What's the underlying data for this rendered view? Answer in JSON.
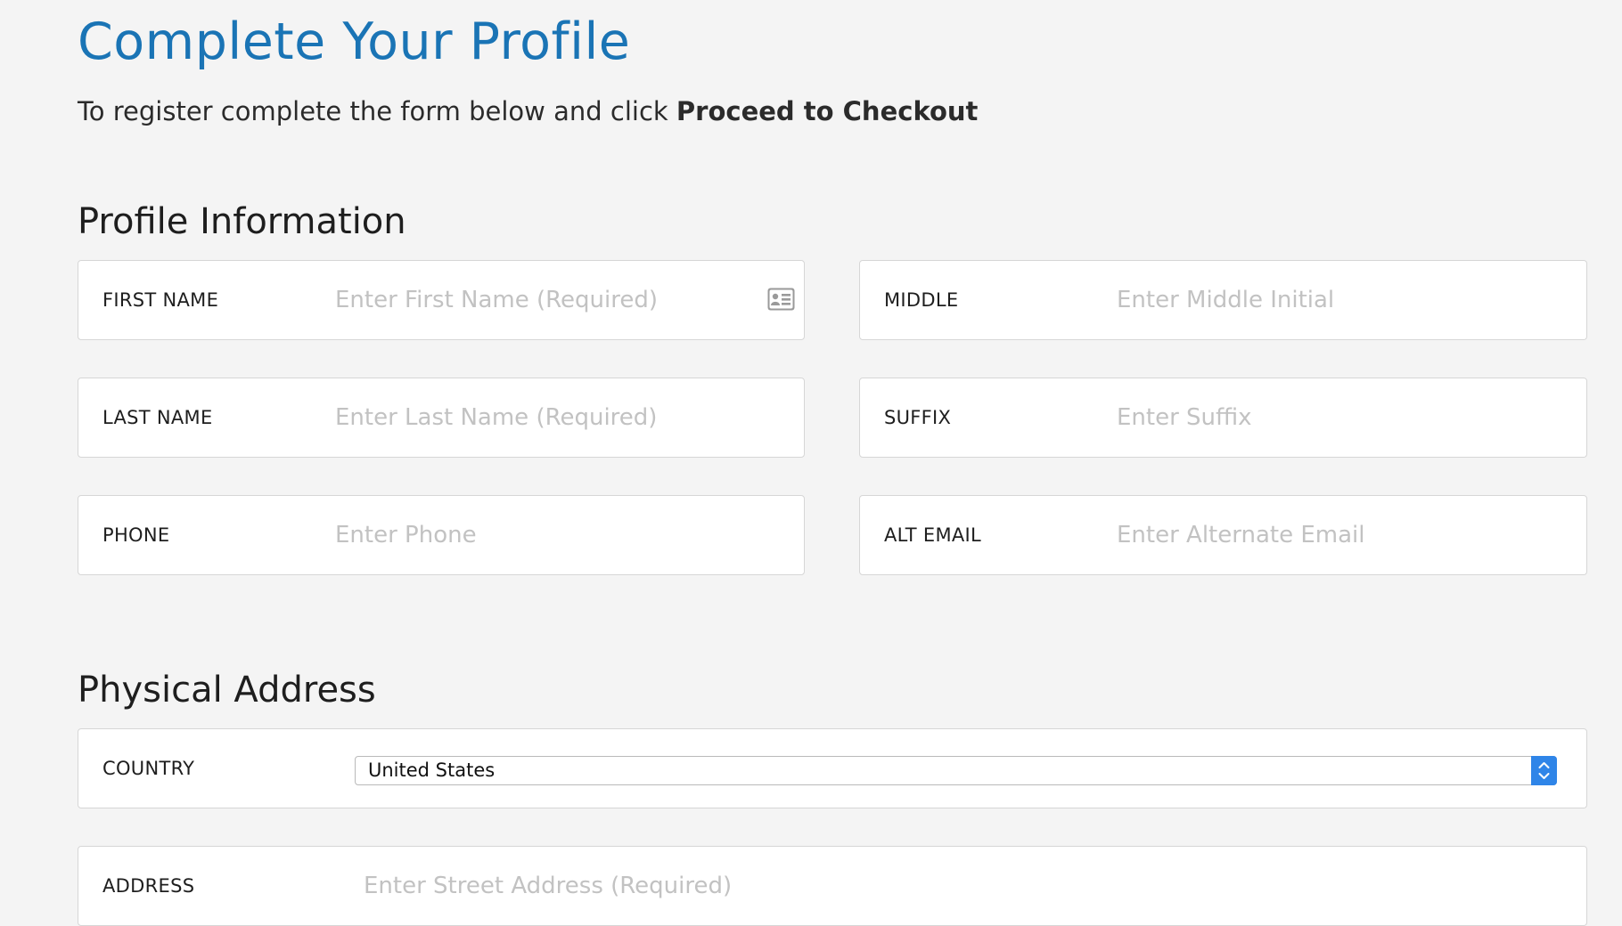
{
  "header": {
    "title": "Complete Your Profile",
    "subtitle_prefix": "To register complete the form below and click ",
    "subtitle_action": "Proceed to Checkout"
  },
  "profile_section": {
    "heading": "Profile Information",
    "fields": {
      "first_name": {
        "label": "FIRST NAME",
        "placeholder": "Enter First Name (Required)",
        "value": ""
      },
      "middle": {
        "label": "MIDDLE",
        "placeholder": "Enter Middle Initial",
        "value": ""
      },
      "last_name": {
        "label": "LAST NAME",
        "placeholder": "Enter Last Name (Required)",
        "value": ""
      },
      "suffix": {
        "label": "SUFFIX",
        "placeholder": "Enter Suffix",
        "value": ""
      },
      "phone": {
        "label": "PHONE",
        "placeholder": "Enter Phone",
        "value": ""
      },
      "alt_email": {
        "label": "ALT EMAIL",
        "placeholder": "Enter Alternate Email",
        "value": ""
      }
    },
    "icons": {
      "first_name_autofill": "contact-card-icon"
    }
  },
  "address_section": {
    "heading": "Physical Address",
    "country": {
      "label": "COUNTRY",
      "selected": "United States",
      "icon": "select-arrows-icon"
    },
    "address": {
      "label": "ADDRESS",
      "placeholder": "Enter Street Address (Required)",
      "value": ""
    }
  },
  "colors": {
    "background": "#f4f4f4",
    "title_blue": "#1a74b5",
    "select_accent": "#2f85e8",
    "placeholder": "#c2c2c2",
    "field_border": "#d6d6d6"
  }
}
